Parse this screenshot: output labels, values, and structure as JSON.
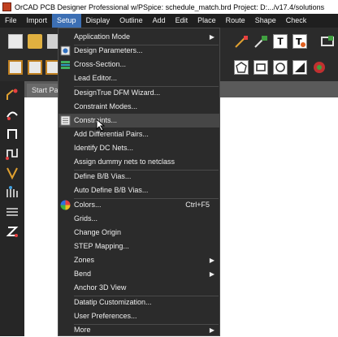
{
  "window": {
    "title": "OrCAD PCB Designer Professional w/PSpice: schedule_match.brd  Project: D:.../v17.4/solutions"
  },
  "menubar": {
    "items": [
      {
        "label": "File"
      },
      {
        "label": "Import"
      },
      {
        "label": "Setup"
      },
      {
        "label": "Display"
      },
      {
        "label": "Outline"
      },
      {
        "label": "Add"
      },
      {
        "label": "Edit"
      },
      {
        "label": "Place"
      },
      {
        "label": "Route"
      },
      {
        "label": "Shape"
      },
      {
        "label": "Check"
      }
    ],
    "active": "Setup"
  },
  "tab": {
    "label": "Start Pag"
  },
  "setup_menu": {
    "items": [
      {
        "label": "Application Mode",
        "submenu": true
      },
      {
        "label": "Design Parameters...",
        "icon": "design-parameters-icon"
      },
      {
        "label": "Cross-Section...",
        "icon": "cross-section-icon"
      },
      {
        "label": "Lead Editor..."
      },
      {
        "label": "DesignTrue DFM Wizard..."
      },
      {
        "label": "Constraint Modes..."
      },
      {
        "label": "Constraints...",
        "icon": "constraints-icon",
        "highlighted": true
      },
      {
        "label": "Add Differential Pairs..."
      },
      {
        "label": "Identify DC Nets..."
      },
      {
        "label": "Assign dummy nets to netclass"
      },
      {
        "label": "Define B/B Vias..."
      },
      {
        "label": "Auto Define B/B Vias..."
      },
      {
        "label": "Colors...",
        "icon": "color-wheel-icon",
        "shortcut": "Ctrl+F5"
      },
      {
        "label": "Grids..."
      },
      {
        "label": "Change Origin"
      },
      {
        "label": "STEP Mapping..."
      },
      {
        "label": "Zones",
        "submenu": true
      },
      {
        "label": "Bend",
        "submenu": true
      },
      {
        "label": "Anchor 3D View"
      },
      {
        "label": "Datatip Customization..."
      },
      {
        "label": "User Preferences..."
      },
      {
        "label": "More",
        "submenu": true
      }
    ],
    "submenu_arrow": "▶"
  },
  "colors": {
    "menubar_bg": "#1f1f1f",
    "active_menu": "#3c6fb4",
    "dropdown_bg": "#2b2b2b",
    "highlight": "#464646",
    "toolbar_bg": "#2b2b2b"
  }
}
